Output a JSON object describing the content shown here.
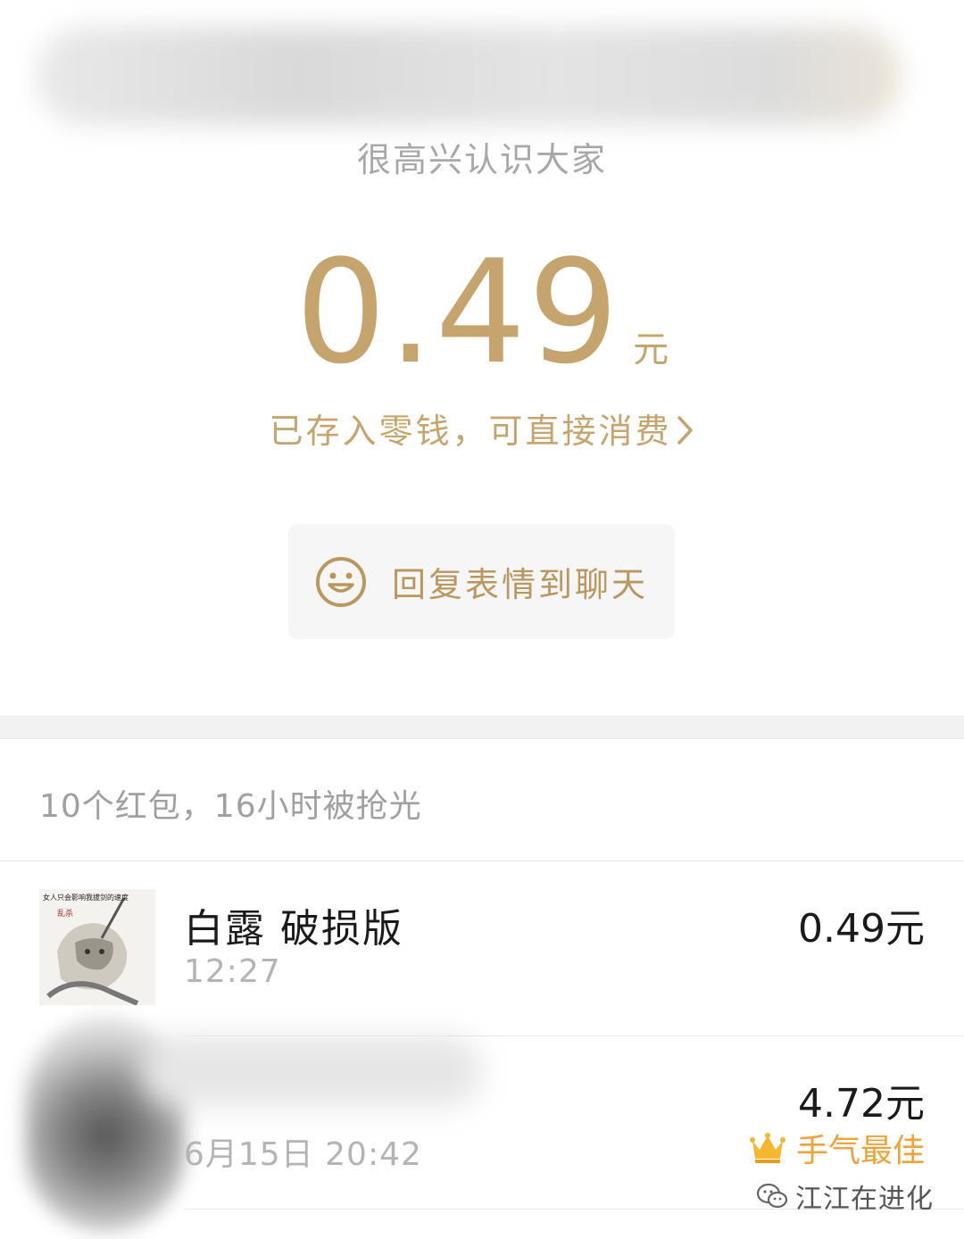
{
  "header": {
    "greeting": "很高兴认识大家"
  },
  "received": {
    "amount": "0.49",
    "unit": "元",
    "stored_link": "已存入零钱，可直接消费"
  },
  "reply_button": {
    "label": "回复表情到聊天",
    "icon": "smiley-face-icon"
  },
  "summary": "10个红包，16小时被抢光",
  "records": [
    {
      "name": "白露 破损版",
      "time": "12:27",
      "amount": "0.49元",
      "avatar_caption": "女人只会影响我拔剑的速度"
    },
    {
      "name": "",
      "time": "6月15日  20:42",
      "amount": "4.72元",
      "badge": "手气最佳",
      "badge_icon": "crown-icon"
    }
  ],
  "watermark": "江江在进化",
  "colors": {
    "gold": "#c5a46d",
    "best_orange": "#f0a33a"
  }
}
